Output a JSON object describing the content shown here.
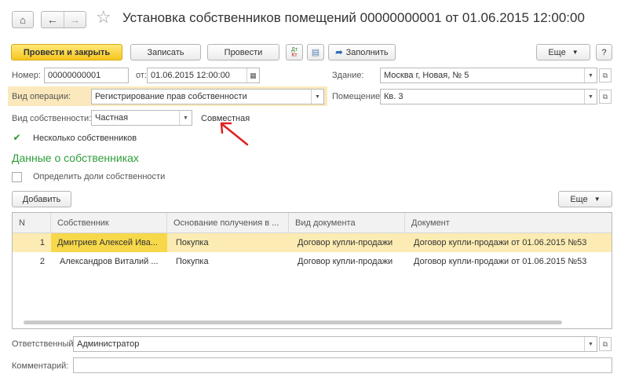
{
  "window": {
    "title": "Установка собственников помещений 00000000001 от 01.06.2015 12:00:00"
  },
  "toolbar": {
    "post_close": "Провести и закрыть",
    "save": "Записать",
    "post": "Провести",
    "fill": "Заполнить",
    "more": "Еще",
    "help": "?"
  },
  "header": {
    "number_label": "Номер:",
    "number_value": "00000000001",
    "date_label": "от:",
    "date_value": "01.06.2015 12:00:00",
    "building_label": "Здание:",
    "building_value": "Москва г, Новая,  № 5",
    "operation_label": "Вид операции:",
    "operation_value": "Регистрирование прав собственности",
    "premises_label": "Помещение:",
    "premises_value": "Кв. 3",
    "ownership_label": "Вид собственности:",
    "ownership_value": "Частная",
    "joint_note": "Совместная",
    "several_owners_label": "Несколько собственников"
  },
  "owners": {
    "section_title": "Данные о собственниках",
    "define_shares_label": "Определить доли собственности",
    "add_button": "Добавить",
    "more_button": "Еще",
    "columns": [
      "N",
      "Собственник",
      "Основание получения в ...",
      "Вид документа",
      "Документ"
    ],
    "rows": [
      {
        "n": "1",
        "owner": "Дмитриев Алексей Ива...",
        "basis": "Покупка",
        "doc_type": "Договор купли-продажи",
        "doc": "Договор купли-продажи от 01.06.2015 №53"
      },
      {
        "n": "2",
        "owner": "Александров Виталий ...",
        "basis": "Покупка",
        "doc_type": "Договор купли-продажи",
        "doc": "Договор купли-продажи от 01.06.2015 №53"
      }
    ]
  },
  "footer": {
    "responsible_label": "Ответственный:",
    "responsible_value": "Администратор",
    "comment_label": "Комментарий:",
    "comment_value": ""
  },
  "colors": {
    "primary_button": "#f6c51f",
    "section_title": "#2f9e3a",
    "selected_row": "#fcecb3",
    "active_cell": "#f7d84a",
    "annotation_arrow": "#e02020"
  }
}
